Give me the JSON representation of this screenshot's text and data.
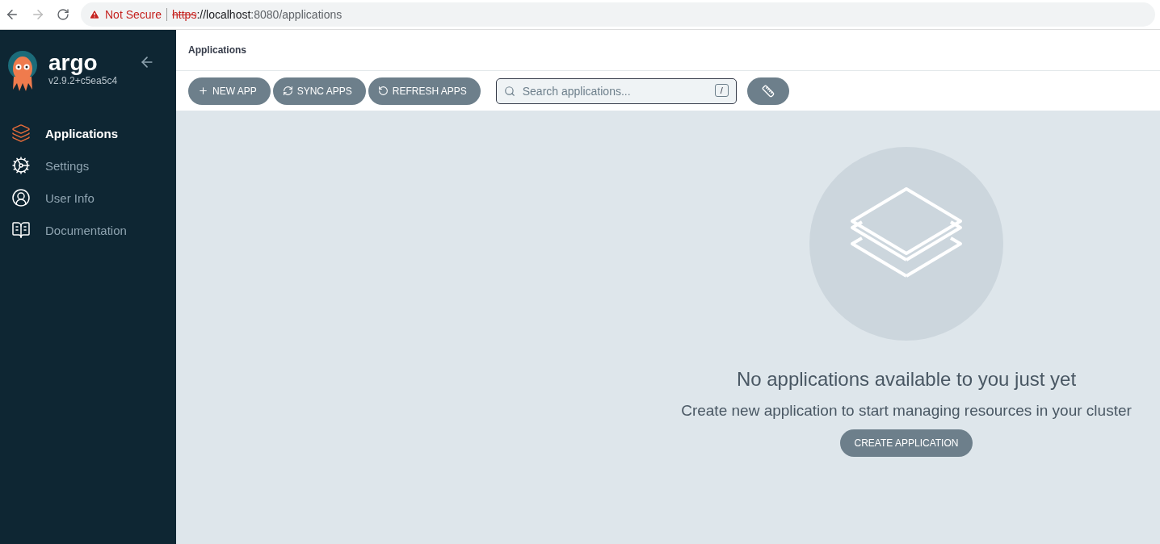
{
  "browser": {
    "security": "Not Secure",
    "url": {
      "scheme": "https",
      "host": "://localhost",
      "path": ":8080/applications"
    }
  },
  "sidebar": {
    "logo": "argo",
    "version": "v2.9.2+c5ea5c4",
    "items": [
      {
        "label": "Applications",
        "selected": true
      },
      {
        "label": "Settings",
        "selected": false
      },
      {
        "label": "User Info",
        "selected": false
      },
      {
        "label": "Documentation",
        "selected": false
      }
    ]
  },
  "page_title": "Applications",
  "toolbar": {
    "buttons": [
      {
        "label": "NEW APP"
      },
      {
        "label": "SYNC APPS"
      },
      {
        "label": "REFRESH APPS"
      }
    ],
    "search": {
      "placeholder": "Search applications...",
      "shortcut": "/"
    }
  },
  "empty_state": {
    "title": "No applications available to you just yet",
    "subtitle": "Create new application to start managing resources in your cluster",
    "button": "CREATE APPLICATION"
  }
}
